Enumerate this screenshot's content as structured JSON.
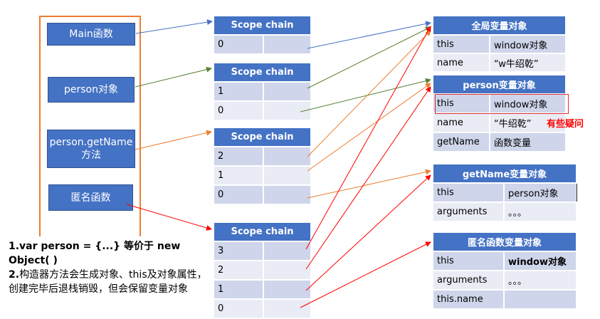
{
  "functions": [
    "Main函数",
    "person对象",
    "person.getName方法",
    "匿名函数"
  ],
  "scope_chains": [
    {
      "header": "Scope chain",
      "rows": [
        "0"
      ]
    },
    {
      "header": "Scope chain",
      "rows": [
        "1",
        "0"
      ]
    },
    {
      "header": "Scope chain",
      "rows": [
        "2",
        "1",
        "0"
      ]
    },
    {
      "header": "Scope chain",
      "rows": [
        "3",
        "2",
        "1",
        "0"
      ]
    }
  ],
  "objects": [
    {
      "header": "全局变量对象",
      "rows": [
        [
          "this",
          "window对象"
        ],
        [
          "name",
          "“w牛绍乾”"
        ]
      ]
    },
    {
      "header": "person变量对象",
      "rows": [
        [
          "this",
          "window对象"
        ],
        [
          "name",
          "“牛绍乾”"
        ],
        [
          "getName",
          "函数变量"
        ]
      ]
    },
    {
      "header": "getName变量对象",
      "rows": [
        [
          "this",
          "person对象"
        ],
        [
          "arguments",
          "。。。"
        ]
      ]
    },
    {
      "header": "匿名函数变量对象",
      "rows": [
        [
          "this",
          "window对象"
        ],
        [
          "arguments",
          "。。。"
        ],
        [
          "this.name",
          ""
        ]
      ]
    }
  ],
  "annotation": "有些疑问",
  "notes": {
    "line1": "1.var person = {...} 等价于 new Object( )",
    "line2_bold": "2.",
    "line2": "构造器方法会生成对象、this及对象属性，创建完毕后退栈销毁，但会保留变量对象"
  },
  "colors": {
    "blue": "#4472C4",
    "green": "#548235",
    "orange": "#ED7D31",
    "red": "#FF0000"
  }
}
